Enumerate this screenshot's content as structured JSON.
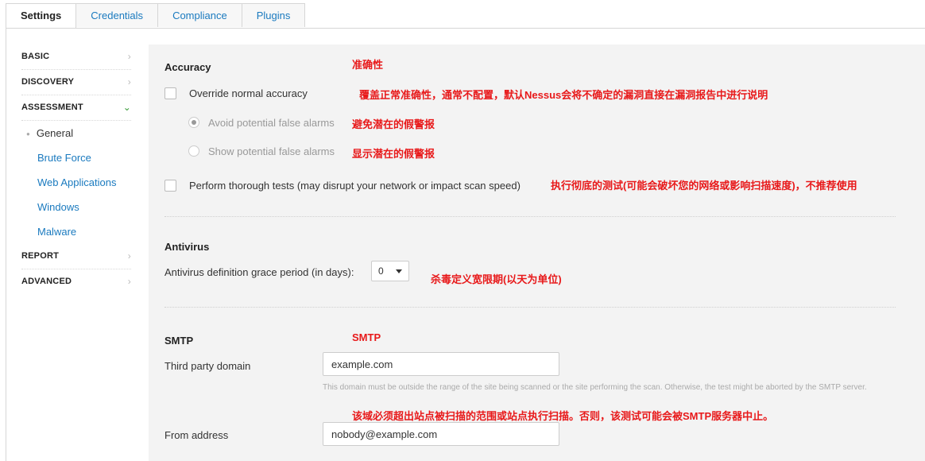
{
  "tabs": [
    {
      "label": "Settings",
      "active": true
    },
    {
      "label": "Credentials",
      "active": false
    },
    {
      "label": "Compliance",
      "active": false
    },
    {
      "label": "Plugins",
      "active": false
    }
  ],
  "sidebar": {
    "sections": [
      {
        "label": "BASIC"
      },
      {
        "label": "DISCOVERY"
      },
      {
        "label": "ASSESSMENT"
      },
      {
        "label": "REPORT"
      },
      {
        "label": "ADVANCED"
      }
    ],
    "assessment_items": [
      "General",
      "Brute Force",
      "Web Applications",
      "Windows",
      "Malware"
    ]
  },
  "accuracy": {
    "heading": "Accuracy",
    "heading_note": "准确性",
    "override_label": "Override normal accuracy",
    "override_note": "覆盖正常准确性，通常不配置，默认Nessus会将不确定的漏洞直接在漏洞报告中进行说明",
    "avoid_label": "Avoid potential false alarms",
    "avoid_note": "避免潜在的假警报",
    "show_label": "Show potential false alarms",
    "show_note": "显示潜在的假警报",
    "thorough_label": "Perform thorough tests (may disrupt your network or impact scan speed)",
    "thorough_note": "执行彻底的测试(可能会破坏您的网络或影响扫描速度)，不推荐使用"
  },
  "antivirus": {
    "heading": "Antivirus",
    "grace_label": "Antivirus definition grace period (in days):",
    "grace_value": "0",
    "grace_note": "杀毒定义宽限期(以天为单位)"
  },
  "smtp": {
    "heading": "SMTP",
    "heading_note": "SMTP",
    "domain_label": "Third party domain",
    "domain_value": "example.com",
    "domain_help": "This domain must be outside the range of the site being scanned or the site performing the scan. Otherwise, the test might be aborted by the SMTP server.",
    "domain_note": "该域必须超出站点被扫描的范围或站点执行扫描。否则，该测试可能会被SMTP服务器中止。",
    "from_label": "From address",
    "from_value": "nobody@example.com"
  }
}
